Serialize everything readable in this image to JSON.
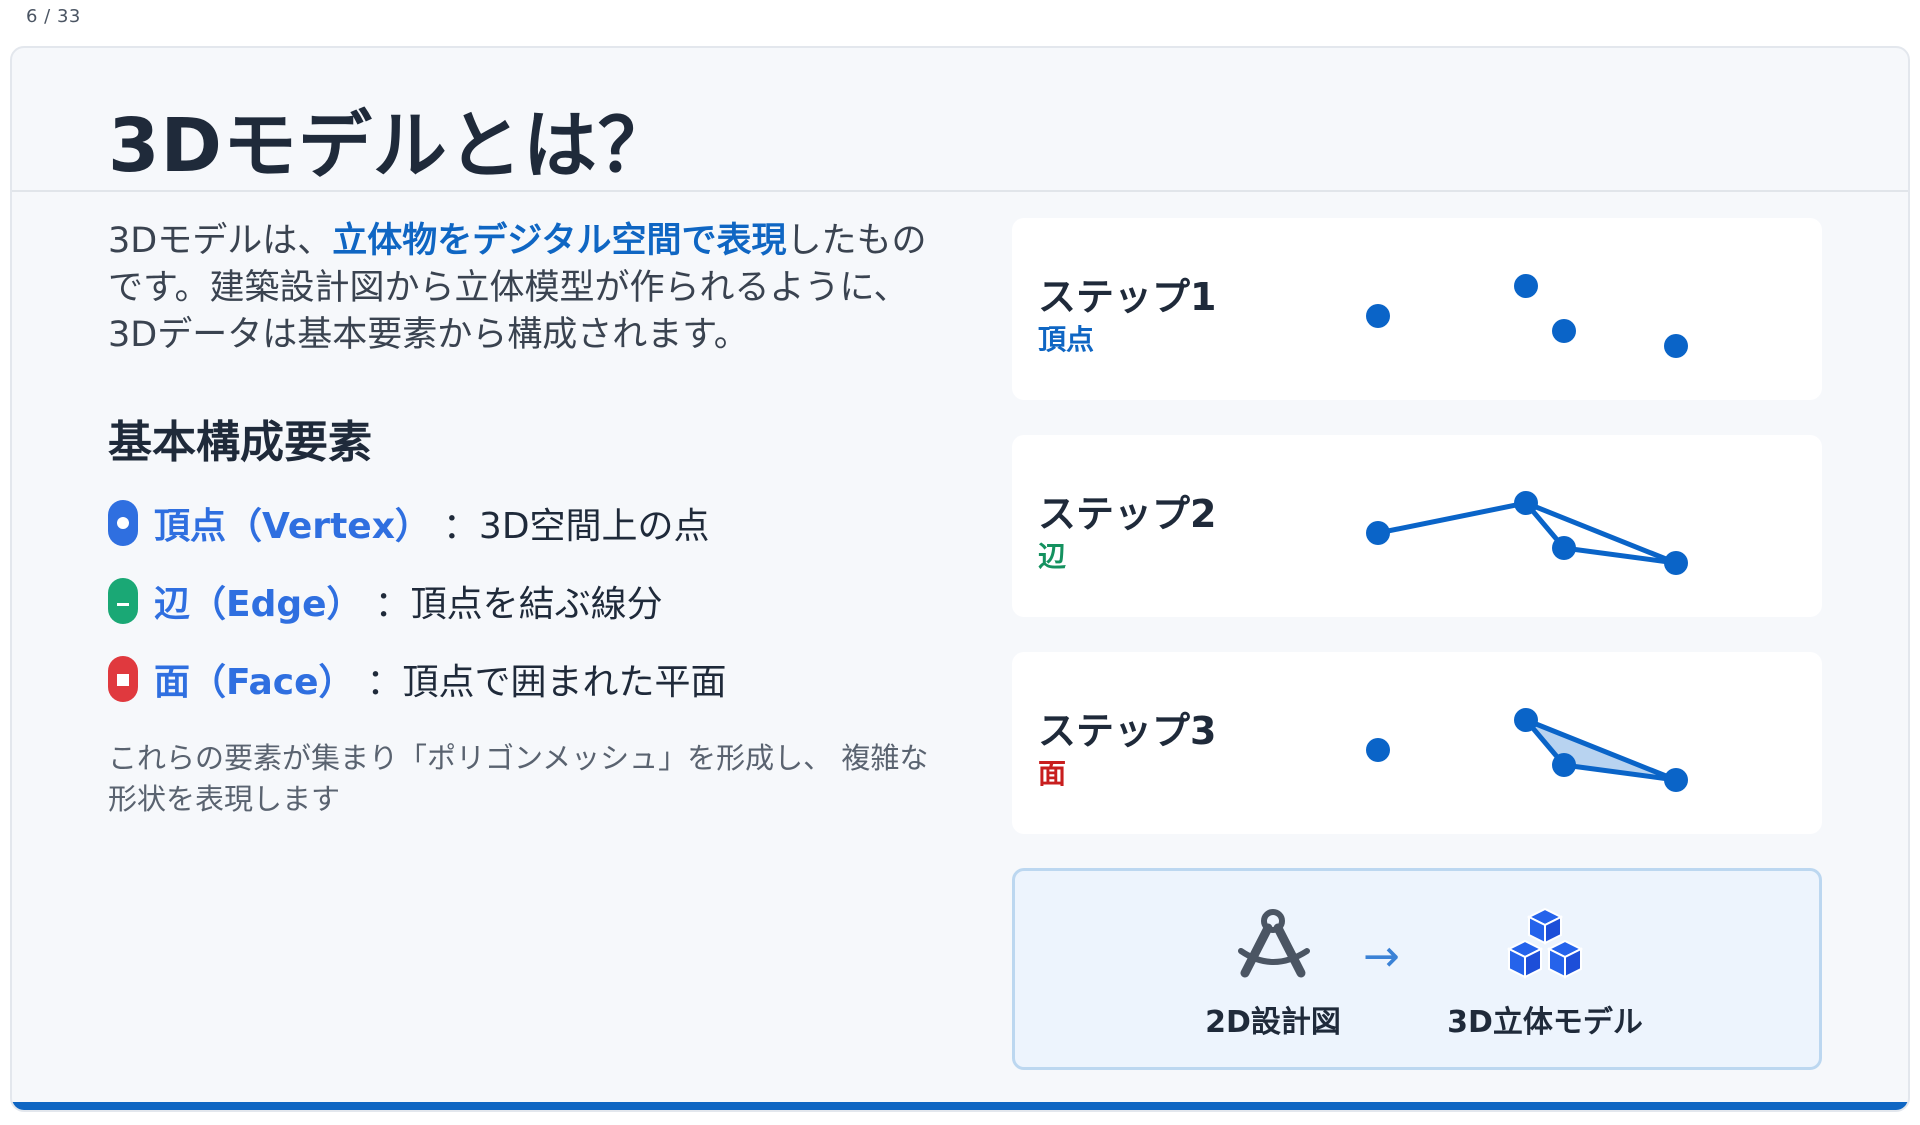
{
  "page_counter": "6 / 33",
  "slide": {
    "title": "3Dモデルとは？",
    "intro": {
      "before": "3Dモデルは、",
      "highlight": "立体物をデジタル空間で表現",
      "after": "したものです。建築設計図から立体模型が作られるように、3Dデータは基本要素から構成されます。"
    },
    "section_heading": "基本構成要素",
    "elements": [
      {
        "term": "頂点（Vertex）",
        "desc": "：3D空間上の点",
        "color": "#2f6fe0",
        "icon": "circle-icon"
      },
      {
        "term": "辺（Edge）",
        "desc": "：頂点を結ぶ線分",
        "color": "#1aa875",
        "icon": "line-icon"
      },
      {
        "term": "面（Face）",
        "desc": "：頂点で囲まれた平面",
        "color": "#e0393e",
        "icon": "square-icon"
      }
    ],
    "note": "これらの要素が集まり「ポリゴンメッシュ」を形成し、 複雑な形状を表現します",
    "steps": [
      {
        "label": "ステップ1",
        "sub": "頂点",
        "sub_color": "#0f66c3"
      },
      {
        "label": "ステップ2",
        "sub": "辺",
        "sub_color": "#14915f"
      },
      {
        "label": "ステップ3",
        "sub": "面",
        "sub_color": "#c81e1e"
      }
    ],
    "flow": {
      "from_label": "2D設計図",
      "arrow": "→",
      "to_label": "3D立体モデル",
      "from_icon": "compass-drafting-icon",
      "to_icon": "cubes-icon"
    },
    "colors": {
      "accent": "#0f66c3",
      "vertex": "#0a64c8",
      "face_fill": "#b8d3f0"
    }
  }
}
